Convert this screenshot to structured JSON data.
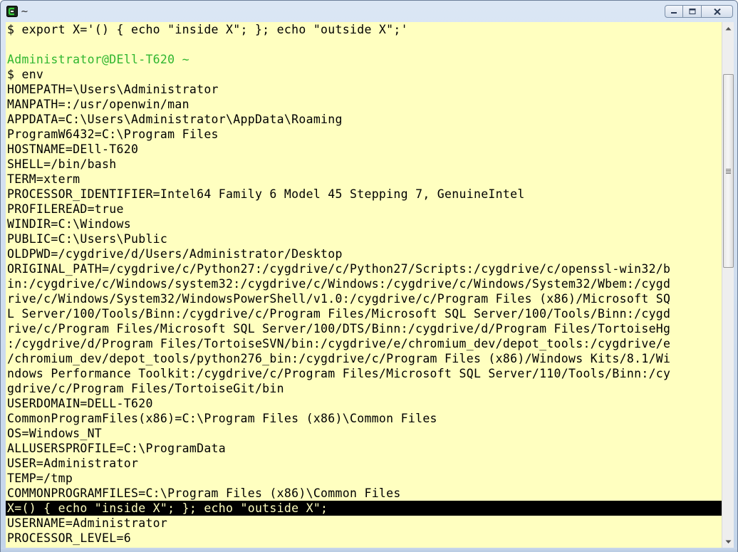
{
  "window": {
    "title": "~",
    "app_icon": "cygwin-terminal-icon",
    "controls": [
      "minimize-icon",
      "maximize-icon",
      "close-icon"
    ]
  },
  "colors": {
    "terminal_background": "#ffffc0",
    "terminal_text": "#000000",
    "prompt_text": "#2fb62f",
    "selection_background": "#000000"
  },
  "terminal": {
    "lines": [
      "$ export X='() { echo \"inside X\"; }; echo \"outside X\";'",
      "",
      "Administrator@DEll-T620 ~",
      "$ env",
      "HOMEPATH=\\Users\\Administrator",
      "MANPATH=:/usr/openwin/man",
      "APPDATA=C:\\Users\\Administrator\\AppData\\Roaming",
      "ProgramW6432=C:\\Program Files",
      "HOSTNAME=DEll-T620",
      "SHELL=/bin/bash",
      "TERM=xterm",
      "PROCESSOR_IDENTIFIER=Intel64 Family 6 Model 45 Stepping 7, GenuineIntel",
      "PROFILEREAD=true",
      "WINDIR=C:\\Windows",
      "PUBLIC=C:\\Users\\Public",
      "OLDPWD=/cygdrive/d/Users/Administrator/Desktop",
      "ORIGINAL_PATH=/cygdrive/c/Python27:/cygdrive/c/Python27/Scripts:/cygdrive/c/openssl-win32/b",
      "in:/cygdrive/c/Windows/system32:/cygdrive/c/Windows:/cygdrive/c/Windows/System32/Wbem:/cygd",
      "rive/c/Windows/System32/WindowsPowerShell/v1.0:/cygdrive/c/Program Files (x86)/Microsoft SQ",
      "L Server/100/Tools/Binn:/cygdrive/c/Program Files/Microsoft SQL Server/100/Tools/Binn:/cygd",
      "rive/c/Program Files/Microsoft SQL Server/100/DTS/Binn:/cygdrive/d/Program Files/TortoiseHg",
      ":/cygdrive/d/Program Files/TortoiseSVN/bin:/cygdrive/e/chromium_dev/depot_tools:/cygdrive/e",
      "/chromium_dev/depot_tools/python276_bin:/cygdrive/c/Program Files (x86)/Windows Kits/8.1/Wi",
      "ndows Performance Toolkit:/cygdrive/c/Program Files/Microsoft SQL Server/110/Tools/Binn:/cy",
      "gdrive/c/Program Files/TortoiseGit/bin",
      "USERDOMAIN=DELL-T620",
      "CommonProgramFiles(x86)=C:\\Program Files (x86)\\Common Files",
      "OS=Windows_NT",
      "ALLUSERSPROFILE=C:\\ProgramData",
      "USER=Administrator",
      "TEMP=/tmp",
      "COMMONPROGRAMFILES=C:\\Program Files (x86)\\Common Files",
      "X=() { echo \"inside X\"; }; echo \"outside X\";",
      "USERNAME=Administrator",
      "PROCESSOR_LEVEL=6"
    ]
  }
}
